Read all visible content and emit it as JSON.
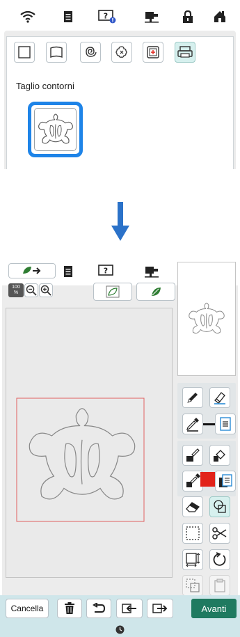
{
  "top": {
    "section_label": "Taglio contorni"
  },
  "bottom": {
    "zoom_level": "100\n%",
    "cancel_label": "Cancella",
    "next_label": "Avanti"
  },
  "colors": {
    "accent_selected": "#1e84e8",
    "fill_color": "#e2231a",
    "line_color": "#111111",
    "next_button": "#1f7a60",
    "cutting_frame": "#e06060"
  },
  "icons": {
    "statusbar": [
      "wifi-icon",
      "document-icon",
      "help-icon",
      "machine-icon",
      "lock-icon",
      "home-icon"
    ],
    "category_tabs": [
      "square-shape-icon",
      "frame-shape-icon",
      "spiral-icon",
      "flower-stamp-icon",
      "embroidery-frame-icon",
      "scanner-icon"
    ],
    "tools": [
      "pencil-icon",
      "line-eraser-icon",
      "line-eyedropper-icon",
      "line-type-icon",
      "brush-icon",
      "fill-bucket-icon",
      "fill-eyedropper-icon",
      "fill-pattern-icon",
      "eraser-icon",
      "shape-icon",
      "select-icon",
      "scissors-icon",
      "resize-icon",
      "rotate-icon",
      "duplicate-icon",
      "paste-icon"
    ]
  }
}
